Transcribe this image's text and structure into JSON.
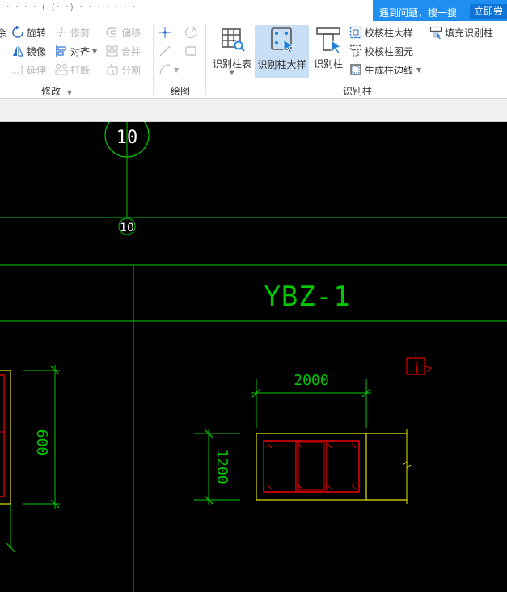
{
  "titlebar": {
    "fragment": "· · · ·  (  (· ·) ·  · ·  · ·  · ·",
    "help_text": "遇到问题，搜一搜",
    "help_button": "立即尝"
  },
  "ribbon": {
    "modify": {
      "label": "修改",
      "rotate": "旋转",
      "trim": "修剪",
      "offset": "偏移",
      "mirror": "镜像",
      "align": "对齐",
      "merge": "合并",
      "extend": "延伸",
      "break": "打断",
      "split": "分割"
    },
    "draw": {
      "label": "绘图"
    },
    "identify_column": {
      "label": "识别柱",
      "column_table": "识别柱表",
      "column_detail": "识别柱大样",
      "column": "识别柱",
      "check_detail": "校核柱大样",
      "check_element": "校核柱图元",
      "gen_edge": "生成柱边线",
      "fill_identify": "填充识别柱"
    }
  },
  "drawing": {
    "axis_circle_label": "10",
    "axis_small_label": "10",
    "title_text": "YBZ-1",
    "dim_width": "2000",
    "dim_height": "1200",
    "dim_left": "600"
  },
  "colors": {
    "accent": "#1e8ff0",
    "cad_green": "#00c800",
    "cad_yellow": "#e6e600",
    "cad_red": "#e00000",
    "canvas_bg": "#000000"
  }
}
